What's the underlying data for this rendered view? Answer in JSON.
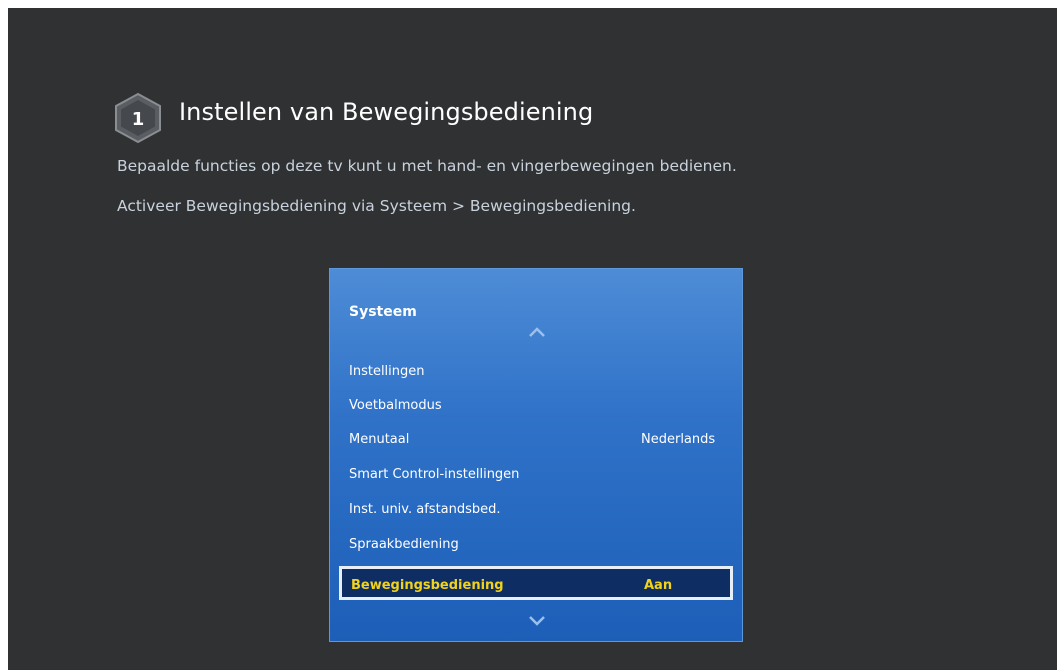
{
  "step": {
    "number": "1",
    "title": "Instellen van Bewegingsbediening",
    "description_line1": "Bepaalde functies op deze tv kunt u met hand- en vingerbewegingen bedienen.",
    "description_line2": "Activeer Bewegingsbediening via Systeem > Bewegingsbediening."
  },
  "menu": {
    "title": "Systeem",
    "items": [
      {
        "label": "Instellingen",
        "value": ""
      },
      {
        "label": "Voetbalmodus",
        "value": ""
      },
      {
        "label": "Menutaal",
        "value": "Nederlands"
      },
      {
        "label": "Smart Control-instellingen",
        "value": ""
      },
      {
        "label": "Inst. univ. afstandsbed.",
        "value": ""
      },
      {
        "label": "Spraakbediening",
        "value": ""
      },
      {
        "label": "Bewegingsbediening",
        "value": "Aan",
        "selected": true
      }
    ]
  },
  "colors": {
    "background": "#2f3133",
    "panel_blue": "#2f72c8",
    "selected_bg": "#0d2d63",
    "selected_text": "#f2d21b"
  },
  "icons": {
    "step": "hexagon-number-icon",
    "scroll_up": "chevron-up-icon",
    "scroll_down": "chevron-down-icon"
  }
}
